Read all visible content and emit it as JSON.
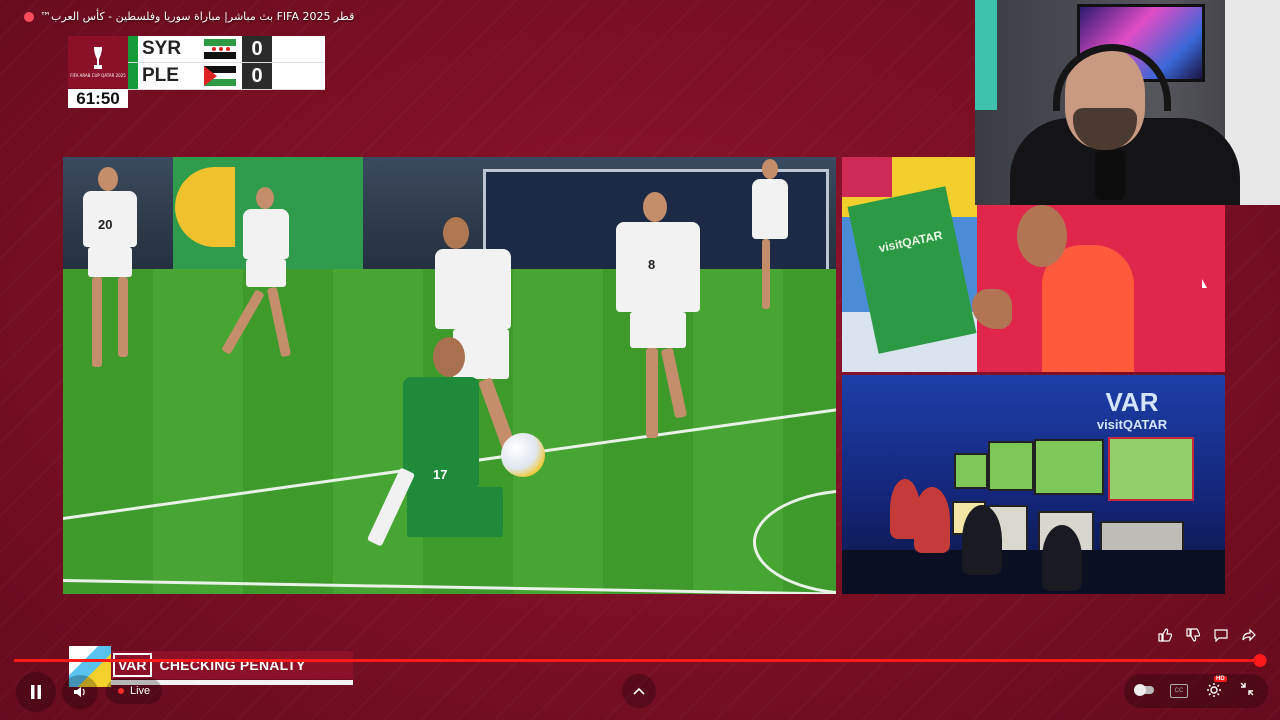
{
  "video": {
    "title": "قطر FIFA 2025 بث مباشر| مباراة سوريا وفلسطين - كأس العرب™"
  },
  "scoreboard": {
    "tournament_logo": "FIFA ARAB CUP QATAR 2025",
    "clock": "61:50",
    "teams": [
      {
        "code": "SYR",
        "score": "0",
        "flag": "syria-flag",
        "color": "#169b3b"
      },
      {
        "code": "PLE",
        "score": "0",
        "flag": "palestine-flag",
        "color": "#169b3b"
      }
    ]
  },
  "var_room": {
    "title": "VAR",
    "sponsor": "visitQATAR"
  },
  "ref_pane": {
    "board_text": "visitQATAR"
  },
  "broadcast_banner": {
    "tag": "VAR",
    "text": "CHECKING PENALTY"
  },
  "player": {
    "live_label": "Live",
    "progress_fraction": 0.995,
    "play_icon": "pause-icon",
    "hd_badge": "HD",
    "cc_label": "CC"
  },
  "jerseys": {
    "p1": "20",
    "p2": "8",
    "p3": "17"
  },
  "colors": {
    "background": "#7a0f24",
    "progress": "#ff1a1a",
    "accent": "#8a1127"
  }
}
